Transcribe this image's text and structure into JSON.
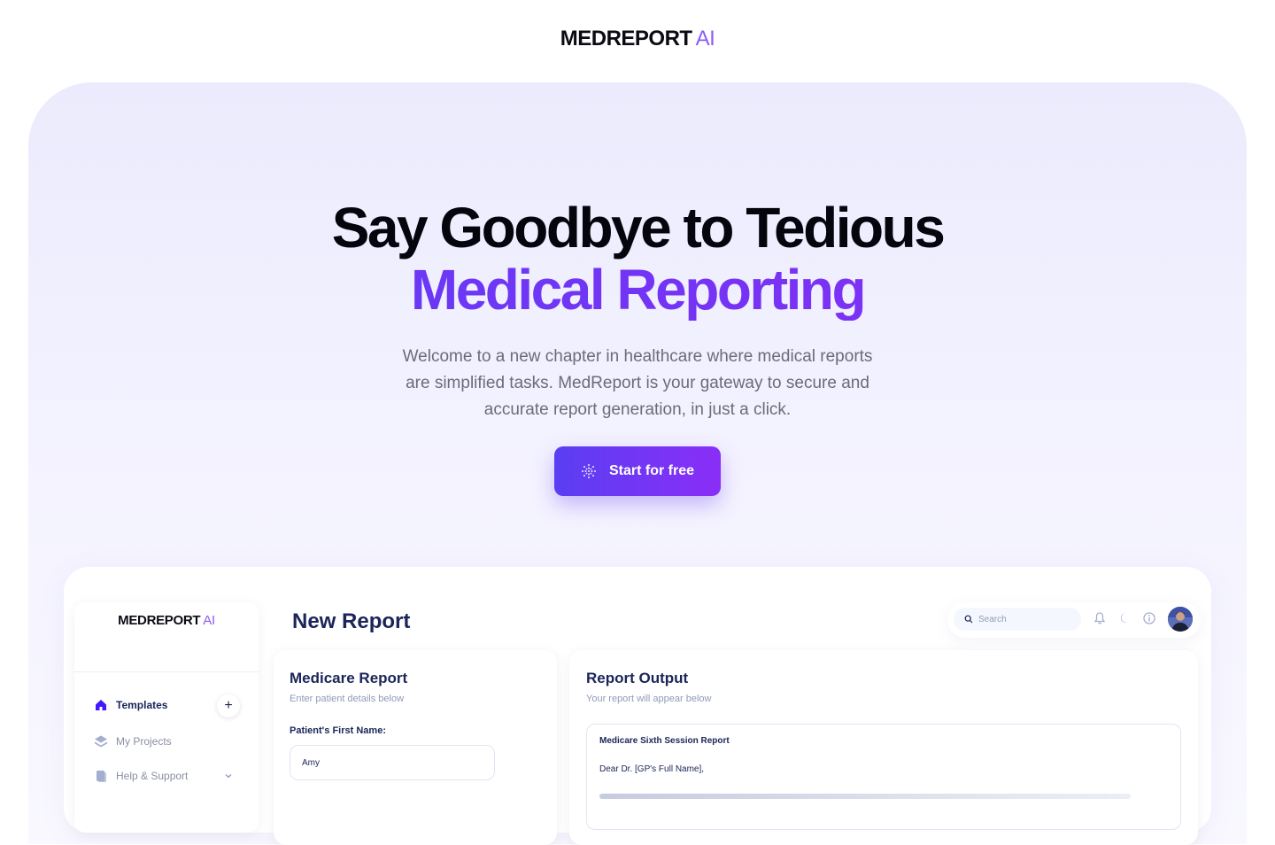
{
  "brand": {
    "name": "MEDREPORT",
    "suffix": "AI"
  },
  "hero": {
    "headline_line1": "Say Goodbye to Tedious",
    "headline_line2": "Medical Reporting",
    "subtitle": "Welcome to a new chapter in healthcare where medical reports are simplified tasks. MedReport is your gateway to secure and accurate report generation, in just a click.",
    "cta_label": "Start for free",
    "cta_icon": "sparkle-grid-icon"
  },
  "app": {
    "brand": {
      "name": "MEDREPORT",
      "suffix": "AI"
    },
    "sidebar": {
      "items": [
        {
          "label": "Templates",
          "icon": "home-icon",
          "active": true
        },
        {
          "label": "My Projects",
          "icon": "layers-icon",
          "active": false
        },
        {
          "label": "Help & Support",
          "icon": "document-icon",
          "active": false
        }
      ]
    },
    "page_title": "New Report",
    "topbar": {
      "search_placeholder": "Search",
      "icons": [
        "bell-icon",
        "moon-icon",
        "info-icon",
        "avatar"
      ]
    },
    "form_card": {
      "title": "Medicare Report",
      "subtitle": "Enter patient details below",
      "field_label": "Patient's First Name:",
      "field_value": "Amy"
    },
    "output_card": {
      "title": "Report Output",
      "subtitle": "Your report will appear below",
      "report_title": "Medicare Sixth Session Report",
      "greeting": "Dear Dr. [GP's Full Name],"
    }
  },
  "colors": {
    "accent_start": "#5a3ef2",
    "accent_end": "#8a2ef7",
    "navy": "#1b2559"
  }
}
